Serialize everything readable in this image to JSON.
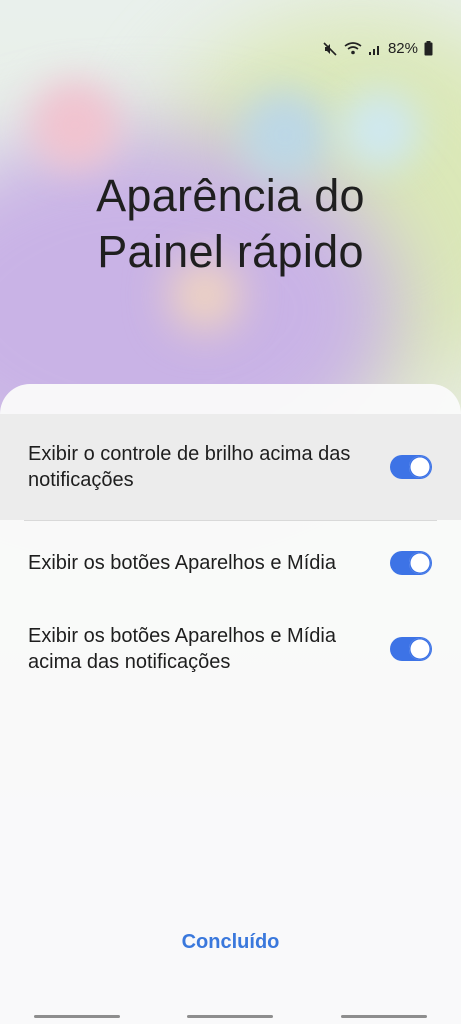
{
  "status_bar": {
    "battery_percent": "82%",
    "icons": [
      "mute-icon",
      "wifi-icon",
      "signal-icon",
      "battery-icon"
    ]
  },
  "title": {
    "line1": "Aparência do",
    "line2": "Painel rápido"
  },
  "options": [
    {
      "label": "Exibir o controle de brilho acima das notificações",
      "enabled": true
    },
    {
      "label": "Exibir os botões Aparelhos e Mídia",
      "enabled": true
    },
    {
      "label": "Exibir os botões Aparelhos e Mídia acima das notificações",
      "enabled": true
    }
  ],
  "done_label": "Concluído",
  "colors": {
    "accent": "#3d73e6",
    "done_text": "#3a78dc"
  }
}
